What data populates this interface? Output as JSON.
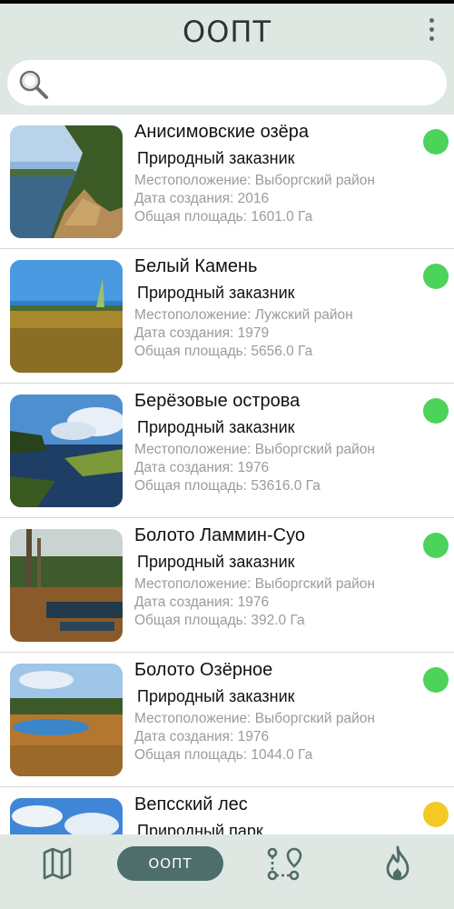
{
  "header": {
    "title": "ООПТ"
  },
  "search": {
    "placeholder": ""
  },
  "colors": {
    "active": "#4cd35a",
    "warning": "#f5c923",
    "accent": "#4e6e6b"
  },
  "items": [
    {
      "name": "Анисимовские озёра",
      "type": "Природный заказник",
      "location": "Местоположение: Выборгский район",
      "created": "Дата создания: 2016",
      "area": "Общая площадь: 1601.0 Га",
      "status_color": "#4cd35a"
    },
    {
      "name": "Белый Камень",
      "type": "Природный заказник",
      "location": "Местоположение: Лужский район",
      "created": "Дата создания: 1979",
      "area": "Общая площадь: 5656.0 Га",
      "status_color": "#4cd35a"
    },
    {
      "name": "Берёзовые острова",
      "type": "Природный заказник",
      "location": "Местоположение: Выборгский район",
      "created": "Дата создания: 1976",
      "area": "Общая площадь: 53616.0 Га",
      "status_color": "#4cd35a"
    },
    {
      "name": "Болото Ламмин-Суо",
      "type": "Природный заказник",
      "location": "Местоположение: Выборгский район",
      "created": "Дата создания: 1976",
      "area": "Общая площадь: 392.0 Га",
      "status_color": "#4cd35a"
    },
    {
      "name": "Болото Озёрное",
      "type": "Природный заказник",
      "location": "Местоположение: Выборгский район",
      "created": "Дата создания: 1976",
      "area": "Общая площадь: 1044.0 Га",
      "status_color": "#4cd35a"
    },
    {
      "name": "Вепсский лес",
      "type": "Природный парк",
      "location": "",
      "created": "",
      "area": "",
      "status_color": "#f5c923"
    }
  ],
  "nav": {
    "active_label": "ООПТ"
  }
}
